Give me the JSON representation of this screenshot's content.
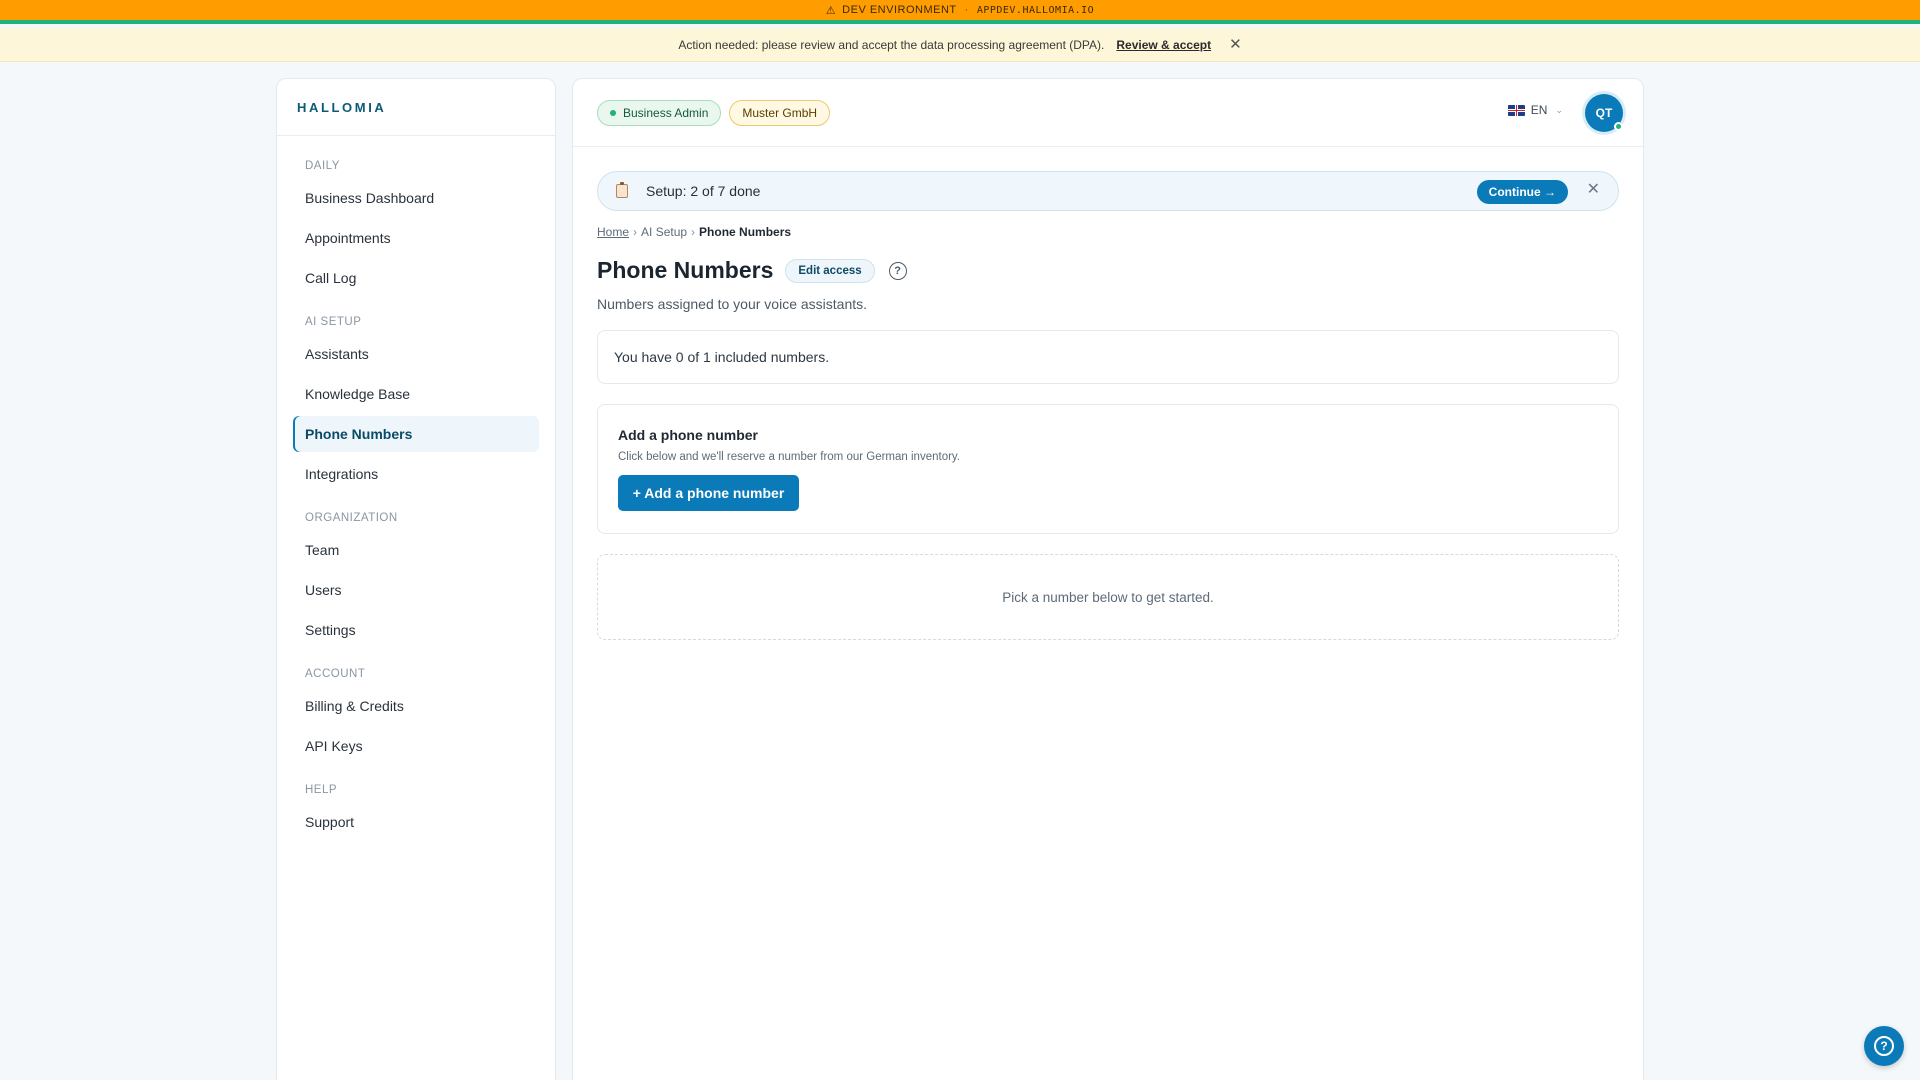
{
  "env_bar": {
    "warning_glyph": "⚠",
    "label": "DEV ENVIRONMENT",
    "separator": "·",
    "host": "APPDEV.HALLOMIA.IO",
    "background": "#ff9c00",
    "accent": "#1db37a"
  },
  "dpa_bar": {
    "message": "Action needed: please review and accept the data processing agreement (DPA).",
    "link": "Review & accept",
    "close_glyph": "✕"
  },
  "sidebar": {
    "brand": "HALLOMIA",
    "sections": [
      {
        "label": "DAILY",
        "items": [
          "Business Dashboard",
          "Appointments",
          "Call Log"
        ]
      },
      {
        "label": "AI SETUP",
        "items": [
          "Assistants",
          "Knowledge Base",
          "Phone Numbers",
          "Integrations"
        ]
      },
      {
        "label": "ORGANIZATION",
        "items": [
          "Team",
          "Users",
          "Settings"
        ]
      },
      {
        "label": "ACCOUNT",
        "items": [
          "Billing & Credits",
          "API Keys"
        ]
      },
      {
        "label": "HELP",
        "items": [
          "Support"
        ]
      }
    ],
    "active_item": "Phone Numbers"
  },
  "header": {
    "role_badge": "Business Admin",
    "org_badge": "Muster GmbH",
    "language": "EN",
    "language_flag": "uk-flag-icon",
    "avatar_initials": "QT"
  },
  "setup": {
    "text": "Setup: 2 of 7 done",
    "continue_label": "Continue →",
    "close_glyph": "✕"
  },
  "breadcrumb": {
    "home": "Home",
    "separator": "›",
    "section": "AI Setup",
    "current": "Phone Numbers"
  },
  "page": {
    "title": "Phone Numbers",
    "edit_access_label": "Edit access",
    "help_glyph": "?",
    "subtitle": "Numbers assigned to your voice assistants."
  },
  "included": {
    "text": "You have 0 of 1 included numbers."
  },
  "add_card": {
    "heading": "Add a phone number",
    "description": "Click below and we'll reserve a number from our German inventory.",
    "button_label": "+ Add a phone number"
  },
  "empty_state": {
    "text": "Pick a number below to get started."
  },
  "fab": {
    "glyph": "?"
  }
}
